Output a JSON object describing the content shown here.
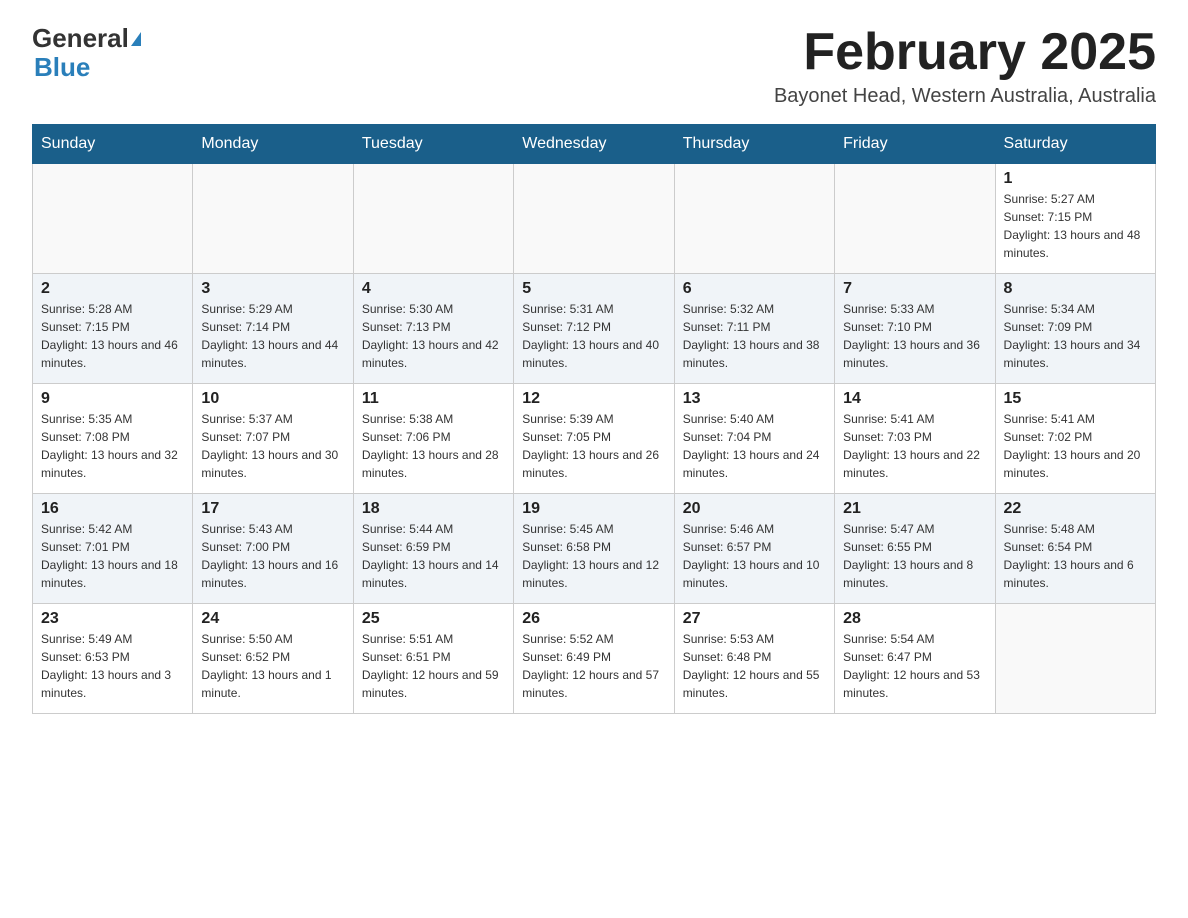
{
  "header": {
    "logo_general": "General",
    "logo_blue": "Blue",
    "month_title": "February 2025",
    "location": "Bayonet Head, Western Australia, Australia"
  },
  "weekdays": [
    "Sunday",
    "Monday",
    "Tuesday",
    "Wednesday",
    "Thursday",
    "Friday",
    "Saturday"
  ],
  "weeks": [
    [
      {
        "day": "",
        "sunrise": "",
        "sunset": "",
        "daylight": ""
      },
      {
        "day": "",
        "sunrise": "",
        "sunset": "",
        "daylight": ""
      },
      {
        "day": "",
        "sunrise": "",
        "sunset": "",
        "daylight": ""
      },
      {
        "day": "",
        "sunrise": "",
        "sunset": "",
        "daylight": ""
      },
      {
        "day": "",
        "sunrise": "",
        "sunset": "",
        "daylight": ""
      },
      {
        "day": "",
        "sunrise": "",
        "sunset": "",
        "daylight": ""
      },
      {
        "day": "1",
        "sunrise": "Sunrise: 5:27 AM",
        "sunset": "Sunset: 7:15 PM",
        "daylight": "Daylight: 13 hours and 48 minutes."
      }
    ],
    [
      {
        "day": "2",
        "sunrise": "Sunrise: 5:28 AM",
        "sunset": "Sunset: 7:15 PM",
        "daylight": "Daylight: 13 hours and 46 minutes."
      },
      {
        "day": "3",
        "sunrise": "Sunrise: 5:29 AM",
        "sunset": "Sunset: 7:14 PM",
        "daylight": "Daylight: 13 hours and 44 minutes."
      },
      {
        "day": "4",
        "sunrise": "Sunrise: 5:30 AM",
        "sunset": "Sunset: 7:13 PM",
        "daylight": "Daylight: 13 hours and 42 minutes."
      },
      {
        "day": "5",
        "sunrise": "Sunrise: 5:31 AM",
        "sunset": "Sunset: 7:12 PM",
        "daylight": "Daylight: 13 hours and 40 minutes."
      },
      {
        "day": "6",
        "sunrise": "Sunrise: 5:32 AM",
        "sunset": "Sunset: 7:11 PM",
        "daylight": "Daylight: 13 hours and 38 minutes."
      },
      {
        "day": "7",
        "sunrise": "Sunrise: 5:33 AM",
        "sunset": "Sunset: 7:10 PM",
        "daylight": "Daylight: 13 hours and 36 minutes."
      },
      {
        "day": "8",
        "sunrise": "Sunrise: 5:34 AM",
        "sunset": "Sunset: 7:09 PM",
        "daylight": "Daylight: 13 hours and 34 minutes."
      }
    ],
    [
      {
        "day": "9",
        "sunrise": "Sunrise: 5:35 AM",
        "sunset": "Sunset: 7:08 PM",
        "daylight": "Daylight: 13 hours and 32 minutes."
      },
      {
        "day": "10",
        "sunrise": "Sunrise: 5:37 AM",
        "sunset": "Sunset: 7:07 PM",
        "daylight": "Daylight: 13 hours and 30 minutes."
      },
      {
        "day": "11",
        "sunrise": "Sunrise: 5:38 AM",
        "sunset": "Sunset: 7:06 PM",
        "daylight": "Daylight: 13 hours and 28 minutes."
      },
      {
        "day": "12",
        "sunrise": "Sunrise: 5:39 AM",
        "sunset": "Sunset: 7:05 PM",
        "daylight": "Daylight: 13 hours and 26 minutes."
      },
      {
        "day": "13",
        "sunrise": "Sunrise: 5:40 AM",
        "sunset": "Sunset: 7:04 PM",
        "daylight": "Daylight: 13 hours and 24 minutes."
      },
      {
        "day": "14",
        "sunrise": "Sunrise: 5:41 AM",
        "sunset": "Sunset: 7:03 PM",
        "daylight": "Daylight: 13 hours and 22 minutes."
      },
      {
        "day": "15",
        "sunrise": "Sunrise: 5:41 AM",
        "sunset": "Sunset: 7:02 PM",
        "daylight": "Daylight: 13 hours and 20 minutes."
      }
    ],
    [
      {
        "day": "16",
        "sunrise": "Sunrise: 5:42 AM",
        "sunset": "Sunset: 7:01 PM",
        "daylight": "Daylight: 13 hours and 18 minutes."
      },
      {
        "day": "17",
        "sunrise": "Sunrise: 5:43 AM",
        "sunset": "Sunset: 7:00 PM",
        "daylight": "Daylight: 13 hours and 16 minutes."
      },
      {
        "day": "18",
        "sunrise": "Sunrise: 5:44 AM",
        "sunset": "Sunset: 6:59 PM",
        "daylight": "Daylight: 13 hours and 14 minutes."
      },
      {
        "day": "19",
        "sunrise": "Sunrise: 5:45 AM",
        "sunset": "Sunset: 6:58 PM",
        "daylight": "Daylight: 13 hours and 12 minutes."
      },
      {
        "day": "20",
        "sunrise": "Sunrise: 5:46 AM",
        "sunset": "Sunset: 6:57 PM",
        "daylight": "Daylight: 13 hours and 10 minutes."
      },
      {
        "day": "21",
        "sunrise": "Sunrise: 5:47 AM",
        "sunset": "Sunset: 6:55 PM",
        "daylight": "Daylight: 13 hours and 8 minutes."
      },
      {
        "day": "22",
        "sunrise": "Sunrise: 5:48 AM",
        "sunset": "Sunset: 6:54 PM",
        "daylight": "Daylight: 13 hours and 6 minutes."
      }
    ],
    [
      {
        "day": "23",
        "sunrise": "Sunrise: 5:49 AM",
        "sunset": "Sunset: 6:53 PM",
        "daylight": "Daylight: 13 hours and 3 minutes."
      },
      {
        "day": "24",
        "sunrise": "Sunrise: 5:50 AM",
        "sunset": "Sunset: 6:52 PM",
        "daylight": "Daylight: 13 hours and 1 minute."
      },
      {
        "day": "25",
        "sunrise": "Sunrise: 5:51 AM",
        "sunset": "Sunset: 6:51 PM",
        "daylight": "Daylight: 12 hours and 59 minutes."
      },
      {
        "day": "26",
        "sunrise": "Sunrise: 5:52 AM",
        "sunset": "Sunset: 6:49 PM",
        "daylight": "Daylight: 12 hours and 57 minutes."
      },
      {
        "day": "27",
        "sunrise": "Sunrise: 5:53 AM",
        "sunset": "Sunset: 6:48 PM",
        "daylight": "Daylight: 12 hours and 55 minutes."
      },
      {
        "day": "28",
        "sunrise": "Sunrise: 5:54 AM",
        "sunset": "Sunset: 6:47 PM",
        "daylight": "Daylight: 12 hours and 53 minutes."
      },
      {
        "day": "",
        "sunrise": "",
        "sunset": "",
        "daylight": ""
      }
    ]
  ]
}
